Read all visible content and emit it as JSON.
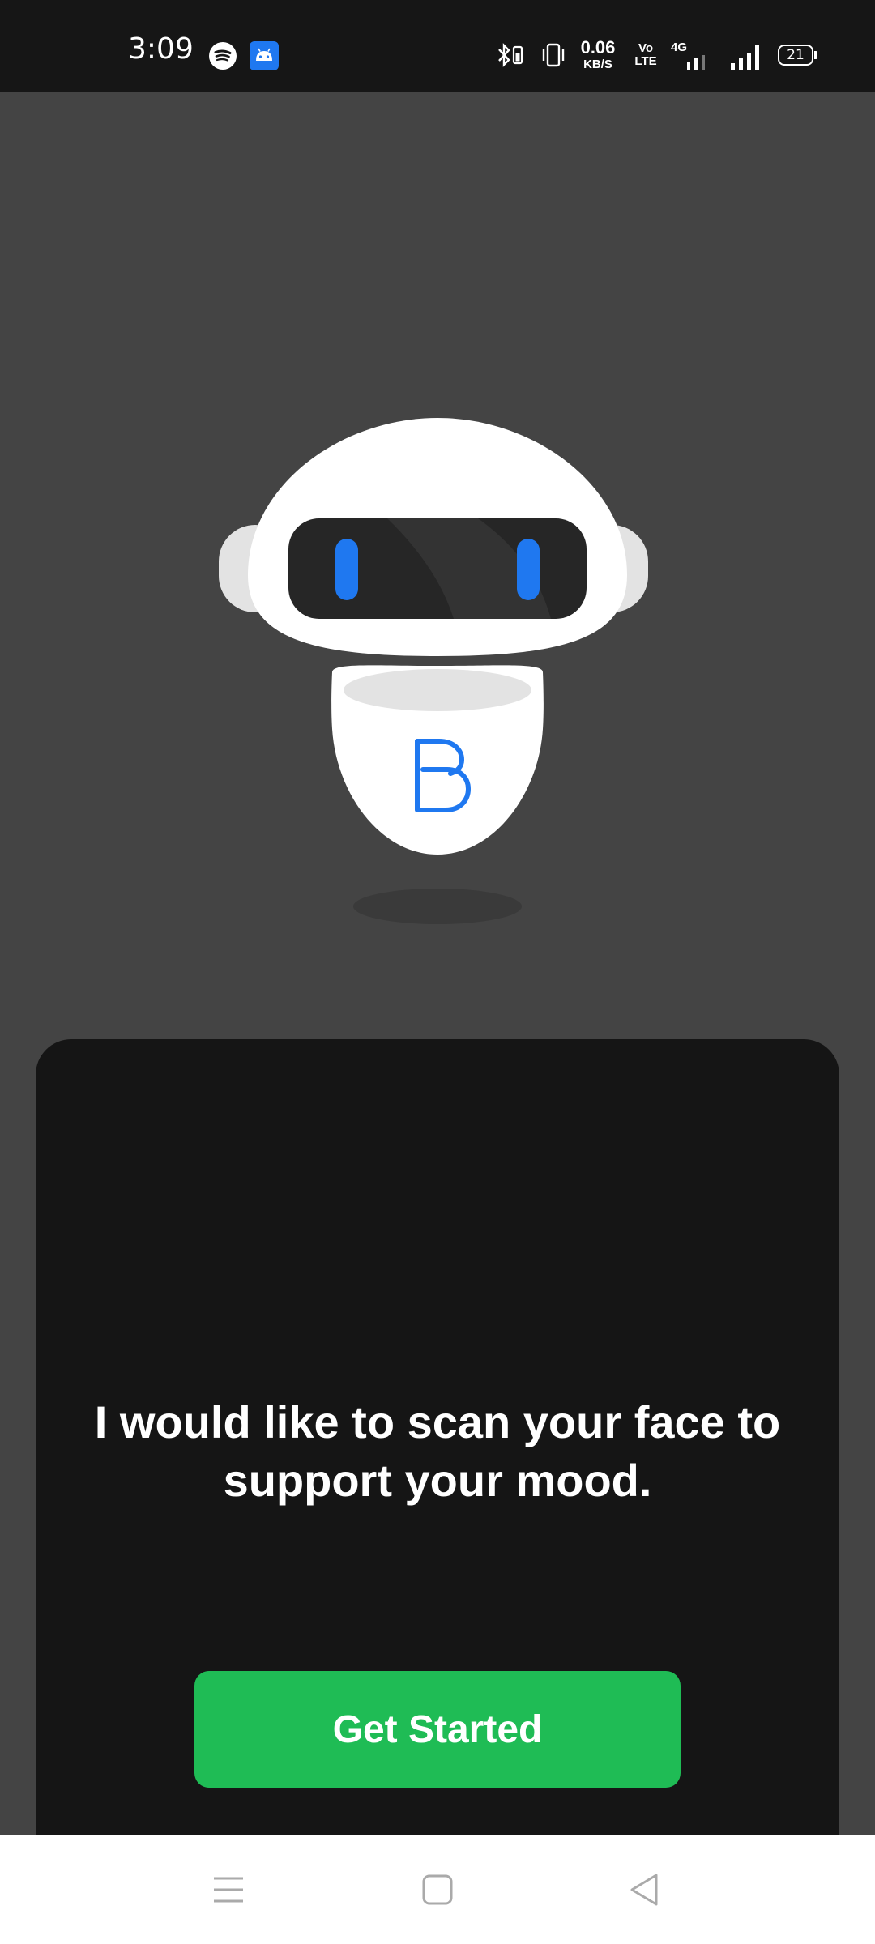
{
  "status_bar": {
    "time": "3:09",
    "icons": [
      "spotify-icon",
      "android-icon",
      "bluetooth-icon",
      "vibrate-icon",
      "volte-icon",
      "signal-icon",
      "battery-icon"
    ],
    "net_speed_value": "0.06",
    "net_speed_unit": "KB/S",
    "volte_top": "Vo",
    "volte_bottom": "LTE",
    "net_type": "4G",
    "battery_level": "21"
  },
  "onboarding": {
    "message": "I would like to scan your face to support your mood.",
    "cta_label": "Get Started",
    "mascot_icon": "robot-mascot-icon",
    "logo_icon": "b-logo-icon"
  },
  "nav_bar": {
    "buttons": [
      "menu-icon",
      "home-icon",
      "back-icon"
    ]
  },
  "colors": {
    "background": "#444444",
    "card": "#151515",
    "accent_blue": "#1f78f0",
    "cta_green": "#1fbc55",
    "status_bar": "#161616"
  }
}
